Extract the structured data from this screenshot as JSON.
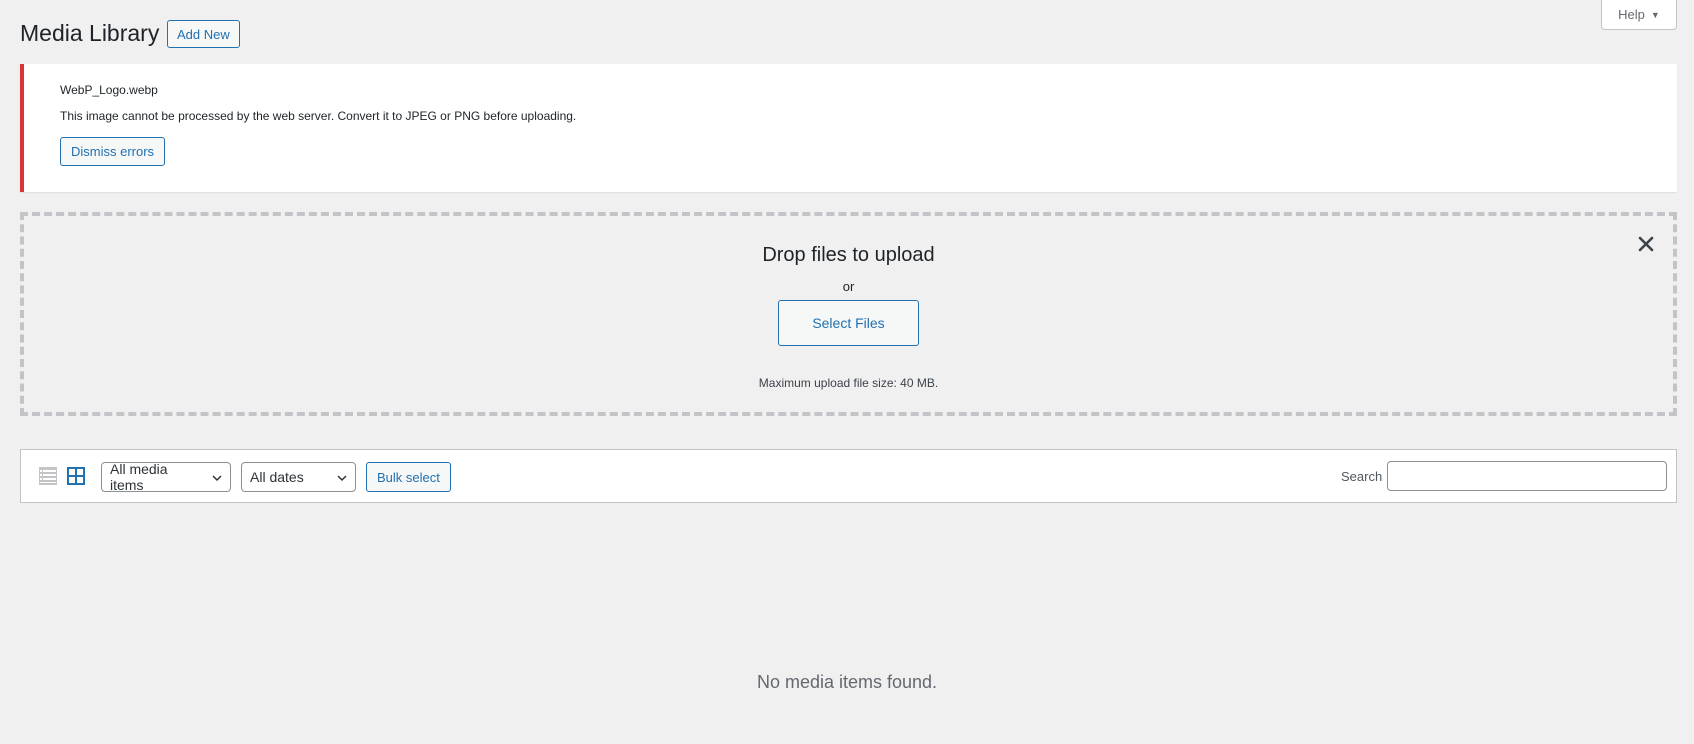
{
  "help_tab": {
    "label": "Help",
    "icon": "caret-down-icon"
  },
  "header": {
    "title": "Media Library",
    "add_new_label": "Add New"
  },
  "error_notice": {
    "filename": "WebP_Logo.webp",
    "message": "This image cannot be processed by the web server. Convert it to JPEG or PNG before uploading.",
    "dismiss_label": "Dismiss errors",
    "accent_color": "#d63638"
  },
  "uploader": {
    "title": "Drop files to upload",
    "or_text": "or",
    "select_files_label": "Select Files",
    "max_size_text": "Maximum upload file size: 40 MB.",
    "close_icon": "close-icon"
  },
  "toolbar": {
    "view_modes": [
      {
        "name": "list",
        "icon": "list-view-icon",
        "active": false
      },
      {
        "name": "grid",
        "icon": "grid-view-icon",
        "active": true
      }
    ],
    "media_filter": {
      "selected": "All media items"
    },
    "date_filter": {
      "selected": "All dates"
    },
    "bulk_select_label": "Bulk select",
    "search_label": "Search",
    "search_value": ""
  },
  "empty_state": {
    "message": "No media items found."
  },
  "colors": {
    "accent": "#2271b1",
    "background": "#f0f0f1",
    "error": "#d63638"
  }
}
